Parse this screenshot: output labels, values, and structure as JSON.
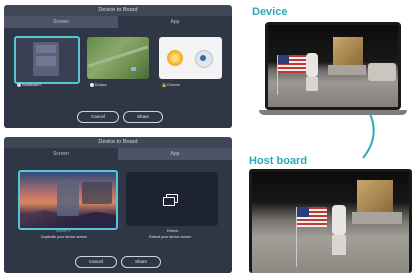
{
  "panel1": {
    "title": "Device to Board",
    "tabs": [
      "Screen",
      "App"
    ],
    "thumbs": [
      {
        "label": "InstaBoard+"
      },
      {
        "label": "Eclipse"
      },
      {
        "label": "Chrome"
      }
    ],
    "buttons": {
      "cancel": "Cancel",
      "share": "Share"
    }
  },
  "panel2": {
    "title": "Device to Board",
    "tabs": [
      "Screen",
      "App"
    ],
    "screen_caption_1": "Screen 1",
    "screen_caption_2": "Duplicate your device screen",
    "extend_caption_1": "Extend",
    "extend_caption_2": "Extend your device screen",
    "buttons": {
      "cancel": "Cancel",
      "share": "Share"
    }
  },
  "labels": {
    "device": "Device",
    "host": "Host board"
  },
  "colors": {
    "accent": "#54c8d6",
    "panel": "#3f4656",
    "body": "#2f3646",
    "title": "#2ba9b8"
  }
}
